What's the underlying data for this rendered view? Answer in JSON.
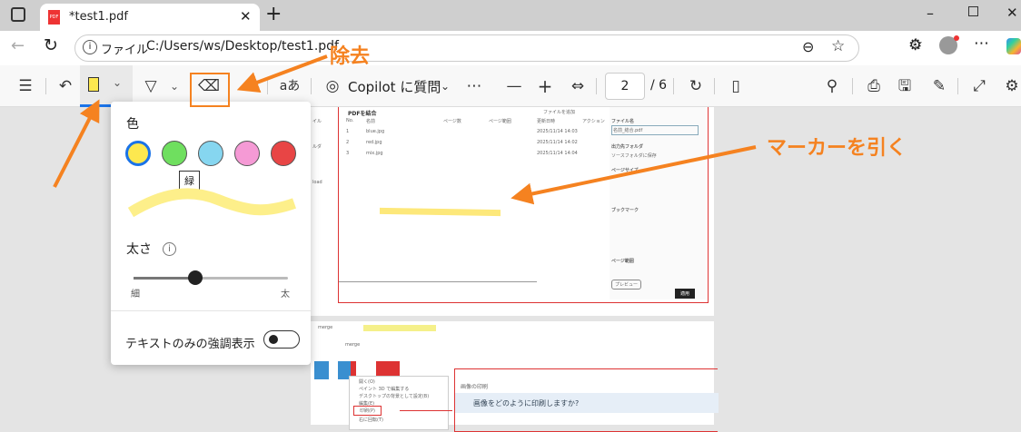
{
  "browser": {
    "tab_title": "*test1.pdf",
    "address_prefix": "ファイル",
    "address": "C:/Users/ws/Desktop/test1.pdf"
  },
  "toolbar": {
    "copilot_label": "Copilot に質問",
    "text_size_label": "aあ",
    "page_current": "2",
    "page_total": "/ 6",
    "zoom_minus": "—",
    "zoom_plus": "+"
  },
  "highlight_panel": {
    "color_heading": "色",
    "colors": [
      {
        "name": "黄",
        "hex": "#fde84f",
        "selected": true
      },
      {
        "name": "緑",
        "hex": "#6fdf5f"
      },
      {
        "name": "水色",
        "hex": "#86d6f0"
      },
      {
        "name": "ピンク",
        "hex": "#f59ad5"
      },
      {
        "name": "赤",
        "hex": "#e84545"
      }
    ],
    "tooltip": "緑",
    "thickness_heading": "太さ",
    "thickness_min": "細",
    "thickness_max": "太",
    "thickness_value_percent": 40,
    "text_only_label": "テキストのみの強調表示",
    "text_only_on": false
  },
  "pdf": {
    "page1": {
      "title": "PDFを結合",
      "add_file": "ファイルを追加",
      "columns": [
        "No.",
        "名前",
        "ページ数",
        "ページ範囲",
        "更新日時",
        "アクション"
      ],
      "rows": [
        [
          "1",
          "blue.jpg",
          "2025/11/14 14:03"
        ],
        [
          "2",
          "red.jpg",
          "2025/11/14 14:02"
        ],
        [
          "3",
          "mix.jpg",
          "2025/11/14 14:04"
        ]
      ],
      "side": [
        "ファイル名",
        "出力先フォルダ",
        "ページサイズ",
        "ブックマーク",
        "ページ範囲"
      ],
      "filename": "名前_結合.pdf",
      "folder": "ソースフォルダに保存",
      "preview": "プレビュー",
      "apply": "適用",
      "left_fragments": [
        "イル",
        "ルダ",
        "load"
      ]
    },
    "page2": {
      "folder": "merge",
      "menu": [
        "開く(O)",
        "ペイント 3D で編集する",
        "デスクトップの背景として設定(B)",
        "編集(E)",
        "印刷(P)",
        "右に回転(T)"
      ],
      "dialog_title": "画像の印刷",
      "dialog_question": "画像をどのように印刷しますか?"
    }
  },
  "annotations": {
    "eraser_label": "除去",
    "marker_label": "マーカーを引く",
    "accent": "#f58220"
  }
}
